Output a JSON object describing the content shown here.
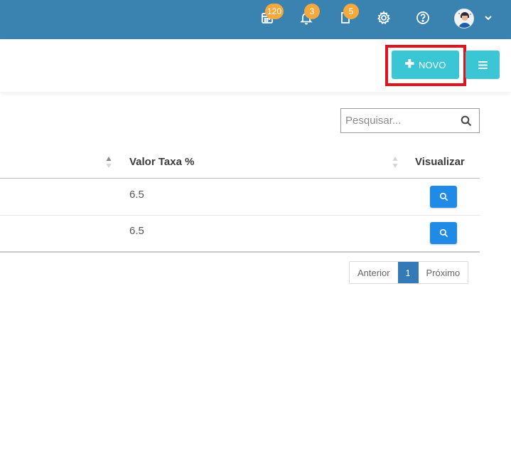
{
  "navbar": {
    "badges": {
      "calendar": "120",
      "notifications": "3",
      "documents": "5"
    }
  },
  "actions": {
    "new_button_label": "NOVO"
  },
  "search": {
    "placeholder": "Pesquisar..."
  },
  "table": {
    "columns": [
      "Valor Taxa %",
      "Visualizar"
    ],
    "rows": [
      {
        "valor_taxa": "6.5"
      },
      {
        "valor_taxa": "6.5"
      }
    ]
  },
  "pagination": {
    "previous": "Anterior",
    "current": "1",
    "next": "Próximo"
  },
  "colors": {
    "navbar": "#3a82b0",
    "badge": "#f5a83c",
    "action_button": "#3ac6d4",
    "highlight": "#e0141f",
    "view_button": "#1f8be6",
    "page_active": "#337ab7"
  }
}
